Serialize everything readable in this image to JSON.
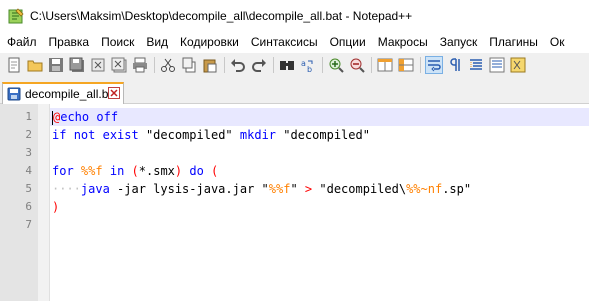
{
  "window": {
    "title": "C:\\Users\\Maksim\\Desktop\\decompile_all\\decompile_all.bat - Notepad++"
  },
  "menu": {
    "items": [
      "Файл",
      "Правка",
      "Поиск",
      "Вид",
      "Кодировки",
      "Синтаксисы",
      "Опции",
      "Макросы",
      "Запуск",
      "Плагины",
      "Ок"
    ]
  },
  "toolbar": {
    "buttons": [
      "new-file-icon",
      "open-file-icon",
      "save-icon",
      "save-all-icon",
      "close-icon",
      "close-all-icon",
      "print-icon",
      "cut-icon",
      "copy-icon",
      "paste-icon",
      "undo-icon",
      "redo-icon",
      "find-icon",
      "replace-icon",
      "zoom-in-icon",
      "zoom-out-icon",
      "sync-vertical-icon",
      "sync-horizontal-icon",
      "word-wrap-icon",
      "show-all-chars-icon",
      "indent-guide-icon",
      "doc-map-icon",
      "function-list-icon"
    ]
  },
  "tab": {
    "label": "decompile_all.bat"
  },
  "editor": {
    "line_numbers": [
      "1",
      "2",
      "3",
      "4",
      "5",
      "6",
      "7"
    ],
    "current_line": 1,
    "lines": [
      [
        {
          "t": "@",
          "c": "at"
        },
        {
          "t": "echo",
          "c": "kw"
        },
        {
          "t": " off",
          "c": "kw"
        }
      ],
      [
        {
          "t": "if",
          "c": "ctrl"
        },
        {
          "t": " ",
          "c": "plain"
        },
        {
          "t": "not",
          "c": "ctrl"
        },
        {
          "t": " ",
          "c": "plain"
        },
        {
          "t": "exist",
          "c": "ctrl"
        },
        {
          "t": " \"decompiled\" ",
          "c": "plain"
        },
        {
          "t": "mkdir",
          "c": "kw"
        },
        {
          "t": " \"decompiled\"",
          "c": "plain"
        }
      ],
      [],
      [
        {
          "t": "for",
          "c": "ctrl"
        },
        {
          "t": " ",
          "c": "plain"
        },
        {
          "t": "%%f",
          "c": "var"
        },
        {
          "t": " ",
          "c": "plain"
        },
        {
          "t": "in",
          "c": "ctrl"
        },
        {
          "t": " ",
          "c": "plain"
        },
        {
          "t": "(",
          "c": "op"
        },
        {
          "t": "*.smx",
          "c": "plain"
        },
        {
          "t": ")",
          "c": "op"
        },
        {
          "t": " ",
          "c": "plain"
        },
        {
          "t": "do",
          "c": "ctrl"
        },
        {
          "t": " ",
          "c": "plain"
        },
        {
          "t": "(",
          "c": "op"
        }
      ],
      [
        {
          "t": "····",
          "c": "ws"
        },
        {
          "t": "java",
          "c": "kw"
        },
        {
          "t": " -jar lysis-java.jar \"",
          "c": "plain"
        },
        {
          "t": "%%f",
          "c": "var"
        },
        {
          "t": "\" ",
          "c": "plain"
        },
        {
          "t": ">",
          "c": "op"
        },
        {
          "t": " \"decompiled\\",
          "c": "plain"
        },
        {
          "t": "%%~nf",
          "c": "var"
        },
        {
          "t": ".sp\"",
          "c": "plain"
        }
      ],
      [
        {
          "t": ")",
          "c": "op"
        }
      ],
      []
    ]
  },
  "colors": {
    "keyword": "#0000ff",
    "variable": "#ff8000",
    "operator": "#ff0000",
    "current_line": "#e8e8ff",
    "tab_accent": "#f5a623"
  }
}
